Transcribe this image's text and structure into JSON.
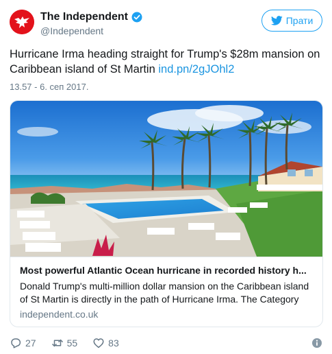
{
  "header": {
    "display_name": "The Independent",
    "handle": "@Independent",
    "verified": true,
    "follow_label": "Прати"
  },
  "tweet": {
    "text": "Hurricane Irma heading straight for Trump's $28m mansion on Caribbean island of St Martin",
    "link": "ind.pn/2gJOhl2",
    "timestamp": "13.57 - 6. сеп 2017."
  },
  "card": {
    "image_icon": "resort-pool-photo",
    "title": "Most powerful Atlantic Ocean hurricane in recorded history h...",
    "description": "Donald Trump's multi-million dollar mansion on the Caribbean island of St Martin is directly in the path of Hurricane Irma. The Category",
    "domain": "independent.co.uk"
  },
  "actions": {
    "replies": "27",
    "retweets": "55",
    "likes": "83"
  },
  "colors": {
    "brand_red": "#e3121b",
    "twitter_blue": "#1da1f2",
    "link_blue": "#1b95e0",
    "muted_gray": "#657786"
  }
}
